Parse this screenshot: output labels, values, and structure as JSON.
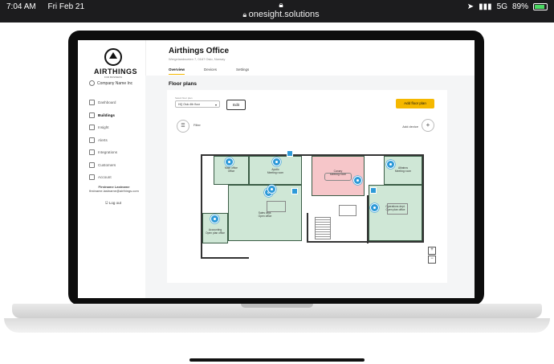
{
  "status_bar": {
    "time": "7:04 AM",
    "date": "Fri Feb 21",
    "url": "onesight.solutions",
    "signal": "5G",
    "battery": "89%"
  },
  "app": {
    "logo_text": "AIRTHINGS",
    "logo_sub": "FOR BUSINESS",
    "company": "Company Name Inc",
    "nav": [
      {
        "label": "Dashboard",
        "icon": "dashboard-icon"
      },
      {
        "label": "Buildings",
        "icon": "building-icon",
        "active": true
      },
      {
        "label": "Insight",
        "icon": "insight-icon"
      },
      {
        "label": "Alerts",
        "icon": "bell-icon"
      },
      {
        "label": "Integrations",
        "icon": "plug-icon"
      },
      {
        "label": "Customers",
        "icon": "people-icon"
      },
      {
        "label": "Account",
        "icon": "gear-icon"
      }
    ],
    "user_name": "Firstname Lastname",
    "user_email": "firstname.lastname@airthings.com",
    "logout": "Log out"
  },
  "page": {
    "title": "Airthings Office",
    "subtitle": "Wergelandsveien 7, 0167 Oslo, Norway",
    "tabs": [
      {
        "label": "Overview",
        "active": true
      },
      {
        "label": "Devices"
      },
      {
        "label": "Settings"
      }
    ],
    "section_title": "Floor plans",
    "select_label": "Select floor plan",
    "select_value": "HQ Oslo 4th floor",
    "edit": "Edit",
    "add_floor_plan": "Add floor plan",
    "filter": "Filter",
    "add_device": "Add device",
    "zoom_in": "+",
    "zoom_out": "−"
  },
  "rooms": [
    {
      "name": "Main office",
      "sub": "Office"
    },
    {
      "name": "Apollo",
      "sub": "Meeting room"
    },
    {
      "name": "Canary",
      "sub": "Meeting room"
    },
    {
      "name": "Albatros",
      "sub": "Meeting room"
    },
    {
      "name": "Sales dept.",
      "sub": "Open office"
    },
    {
      "name": "Accounting",
      "sub": "Open plan office"
    },
    {
      "name": "Operations dept.",
      "sub": "Open plan office"
    }
  ]
}
